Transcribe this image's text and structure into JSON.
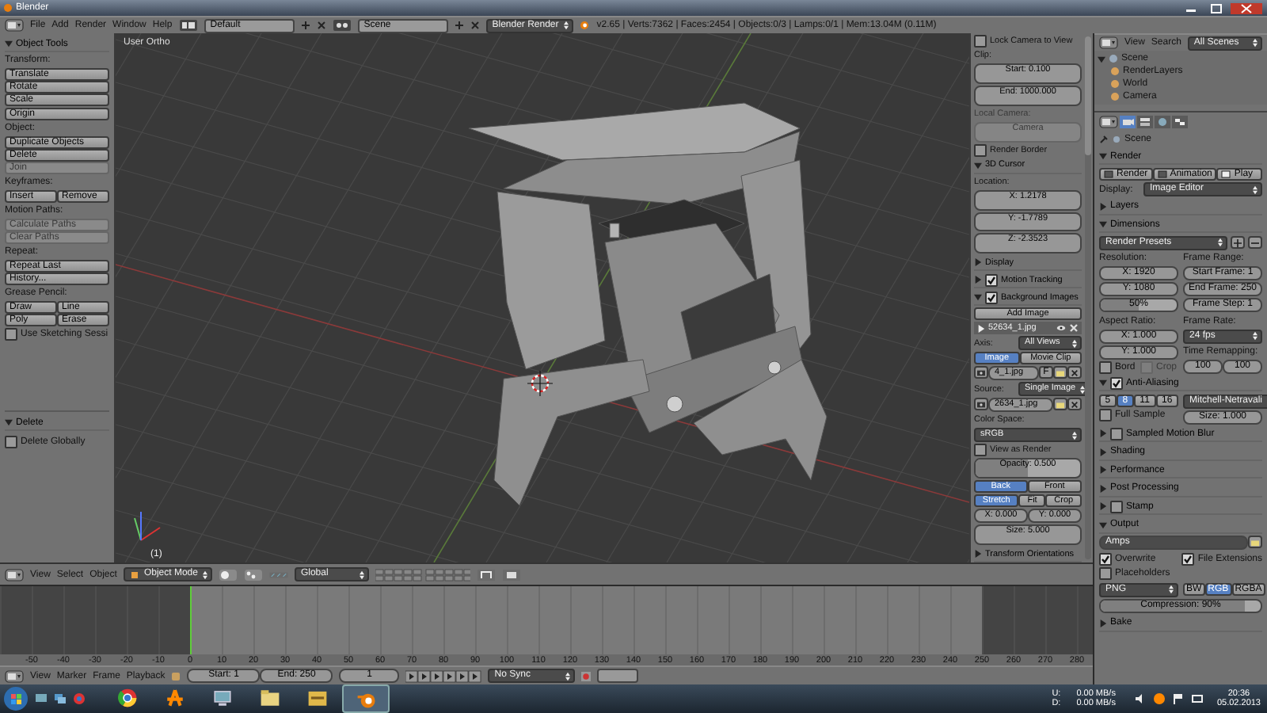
{
  "title_bar": {
    "title": "Blender"
  },
  "info_header": {
    "menus": [
      "File",
      "Add",
      "Render",
      "Window",
      "Help"
    ],
    "layout": "Default",
    "scene": "Scene",
    "engine": "Blender Render",
    "stats": "v2.65 | Verts:7362 | Faces:2454 | Objects:0/3 | Lamps:0/1 | Mem:13.04M (0.11M)"
  },
  "tool_shelf": {
    "items": [
      {
        "kind": "panel",
        "label": "Object Tools",
        "expanded": true
      },
      {
        "kind": "label",
        "text": "Transform:"
      },
      {
        "kind": "stack",
        "items": [
          {
            "label": "Translate",
            "disabled": false
          },
          {
            "label": "Rotate",
            "disabled": false
          },
          {
            "label": "Scale",
            "disabled": false
          }
        ]
      },
      {
        "kind": "stack",
        "items": [
          {
            "label": "Origin",
            "disabled": false
          }
        ]
      },
      {
        "kind": "label",
        "text": "Object:"
      },
      {
        "kind": "stack",
        "items": [
          {
            "label": "Duplicate Objects",
            "disabled": false
          },
          {
            "label": "Delete",
            "disabled": false
          },
          {
            "label": "Join",
            "disabled": true
          }
        ]
      },
      {
        "kind": "label",
        "text": "Keyframes:"
      },
      {
        "kind": "buttons",
        "items": [
          {
            "label": "Insert",
            "disabled": false
          },
          {
            "label": "Remove",
            "disabled": false
          }
        ]
      },
      {
        "kind": "label",
        "text": "Motion Paths:"
      },
      {
        "kind": "stack",
        "items": [
          {
            "label": "Calculate Paths",
            "disabled": true
          },
          {
            "label": "Clear Paths",
            "disabled": true
          }
        ]
      },
      {
        "kind": "label",
        "text": "Repeat:"
      },
      {
        "kind": "stack",
        "items": [
          {
            "label": "Repeat Last",
            "disabled": false
          },
          {
            "label": "History...",
            "disabled": false
          }
        ]
      },
      {
        "kind": "label",
        "text": "Grease Pencil:"
      },
      {
        "kind": "grid",
        "rows": [
          [
            {
              "label": "Draw",
              "disabled": false
            },
            {
              "label": "Line",
              "disabled": false
            }
          ],
          [
            {
              "label": "Poly",
              "disabled": false
            },
            {
              "label": "Erase",
              "disabled": false
            }
          ]
        ]
      },
      {
        "kind": "checkbox",
        "label": "Use Sketching Sessi",
        "checked": false
      }
    ],
    "operator_items": [
      {
        "kind": "panel",
        "label": "Delete",
        "expanded": true
      },
      {
        "kind": "checkbox",
        "label": "Delete Globally",
        "checked": false
      }
    ]
  },
  "viewport": {
    "view_name": "User Ortho",
    "frame": "(1)"
  },
  "n_panel": {
    "items": [
      {
        "kind": "checkbox",
        "label": "Lock Camera to View",
        "checked": false
      },
      {
        "kind": "label",
        "text": "Clip:"
      },
      {
        "kind": "field",
        "text": "Start: 0.100"
      },
      {
        "kind": "field",
        "text": "End: 1000.000"
      },
      {
        "kind": "label",
        "text": "Local Camera:",
        "disabled": true
      },
      {
        "kind": "field",
        "text": "Camera",
        "disabled": true
      },
      {
        "kind": "checkbox",
        "label": "Render Border",
        "checked": false
      },
      {
        "kind": "panel",
        "label": "3D Cursor",
        "expanded": true
      },
      {
        "kind": "label",
        "text": "Location:"
      },
      {
        "kind": "field",
        "text": "X: 1.2178"
      },
      {
        "kind": "field",
        "text": "Y: -1.7789"
      },
      {
        "kind": "field",
        "text": "Z: -2.3523"
      },
      {
        "kind": "panel",
        "label": "Display",
        "expanded": false
      },
      {
        "kind": "panel",
        "label": "Motion Tracking",
        "expanded": false,
        "checked": true
      },
      {
        "kind": "panel",
        "label": "Background Images",
        "expanded": true,
        "checked": true
      },
      {
        "kind": "button",
        "label": "Add Image"
      },
      {
        "kind": "image",
        "name": "52634_1.jpg"
      },
      {
        "kind": "dropdown",
        "label": "Axis:",
        "value": "All Views"
      },
      {
        "kind": "segmented",
        "items": [
          {
            "label": "Image",
            "selected": true
          },
          {
            "label": "Movie Clip",
            "selected": false
          }
        ]
      },
      {
        "kind": "image_select",
        "value": "4_1.jpg",
        "flag": "F"
      },
      {
        "kind": "dropdown",
        "label": "Source:",
        "value": "Single Image"
      },
      {
        "kind": "image_select",
        "value": "2634_1.jpg"
      },
      {
        "kind": "label",
        "text": "Color Space:"
      },
      {
        "kind": "dropdown",
        "value": "sRGB"
      },
      {
        "kind": "checkbox",
        "label": "View as Render",
        "checked": false
      },
      {
        "kind": "slider",
        "text": "Opacity: 0.500",
        "level": 0.5
      },
      {
        "kind": "segmented",
        "items": [
          {
            "label": "Back",
            "selected": true
          },
          {
            "label": "Front",
            "selected": false
          }
        ]
      },
      {
        "kind": "segmented",
        "items": [
          {
            "label": "Stretch",
            "selected": true
          },
          {
            "label": "Fit",
            "selected": false
          },
          {
            "label": "Crop",
            "selected": false
          }
        ]
      },
      {
        "kind": "fields",
        "items": [
          "X: 0.000",
          "Y: 0.000"
        ]
      },
      {
        "kind": "field",
        "text": "Size: 5.000"
      },
      {
        "kind": "panel",
        "label": "Transform Orientations",
        "expanded": false
      }
    ]
  },
  "outliner": {
    "menus": [
      "View",
      "Search"
    ],
    "filter": "All Scenes",
    "tree": [
      {
        "label": "Scene",
        "expanded": true,
        "children": [
          {
            "label": "RenderLayers"
          },
          {
            "label": "World"
          },
          {
            "label": "Camera"
          }
        ]
      }
    ]
  },
  "properties": {
    "tabs": [
      {
        "selected": true
      },
      {
        "selected": false
      },
      {
        "selected": false
      },
      {
        "selected": false
      }
    ],
    "context": "Scene",
    "items": [
      {
        "kind": "panel",
        "label": "Render",
        "expanded": true
      },
      {
        "kind": "buttons",
        "items": [
          {
            "label": "Render",
            "disabled": false
          },
          {
            "label": "Animation",
            "disabled": false
          },
          {
            "label": "Play",
            "disabled": false
          }
        ]
      },
      {
        "kind": "dropdown",
        "label": "Display:",
        "value": "Image Editor"
      },
      {
        "kind": "panel",
        "label": "Layers",
        "expanded": false
      },
      {
        "kind": "panel",
        "label": "Dimensions",
        "expanded": true
      },
      {
        "kind": "presets",
        "value": "Render Presets"
      },
      {
        "kind": "columns",
        "columns": [
          [
            {
              "kind": "label",
              "text": "Resolution:"
            },
            {
              "kind": "field",
              "text": "X: 1920"
            },
            {
              "kind": "field",
              "text": "Y: 1080"
            },
            {
              "kind": "slider",
              "text": "50%",
              "level": 0.5
            }
          ],
          [
            {
              "kind": "label",
              "text": "Frame Range:"
            },
            {
              "kind": "field",
              "text": "Start Frame: 1"
            },
            {
              "kind": "field",
              "text": "End Frame: 250"
            },
            {
              "kind": "field",
              "text": "Frame Step: 1"
            }
          ]
        ]
      },
      {
        "kind": "columns",
        "columns": [
          [
            {
              "kind": "label",
              "text": "Aspect Ratio:"
            },
            {
              "kind": "field",
              "text": "X: 1.000"
            },
            {
              "kind": "field",
              "text": "Y: 1.000"
            },
            {
              "kind": "checkboxes",
              "items": [
                {
                  "label": "Bord",
                  "checked": false,
                  "disabled": false
                },
                {
                  "label": "Crop",
                  "checked": false,
                  "disabled": true
                }
              ]
            }
          ],
          [
            {
              "kind": "label",
              "text": "Frame Rate:"
            },
            {
              "kind": "dropdown",
              "value": "24 fps"
            },
            {
              "kind": "label",
              "text": "Time Remapping:"
            },
            {
              "kind": "fields",
              "items": [
                "100",
                "100"
              ]
            }
          ]
        ]
      },
      {
        "kind": "panel",
        "label": "Anti-Aliasing",
        "expanded": true,
        "checked": true
      },
      {
        "kind": "columns",
        "columns": [
          [
            {
              "kind": "segmented",
              "items": [
                {
                  "label": "5",
                  "selected": false
                },
                {
                  "label": "8",
                  "selected": true
                },
                {
                  "label": "11",
                  "selected": false
                },
                {
                  "label": "16",
                  "selected": false
                }
              ]
            },
            {
              "kind": "checkbox",
              "label": "Full Sample",
              "checked": false
            }
          ],
          [
            {
              "kind": "dropdown",
              "value": "Mitchell-Netravali"
            },
            {
              "kind": "field",
              "text": "Size: 1.000"
            }
          ]
        ]
      },
      {
        "kind": "panel",
        "label": "Sampled Motion Blur",
        "expanded": false,
        "checked": false
      },
      {
        "kind": "panel",
        "label": "Shading",
        "expanded": false
      },
      {
        "kind": "panel",
        "label": "Performance",
        "expanded": false
      },
      {
        "kind": "panel",
        "label": "Post Processing",
        "expanded": false
      },
      {
        "kind": "panel",
        "label": "Stamp",
        "expanded": false,
        "checked": false
      },
      {
        "kind": "panel",
        "label": "Output",
        "expanded": true
      },
      {
        "kind": "path",
        "value": "Amps"
      },
      {
        "kind": "checkboxes",
        "items": [
          {
            "label": "Overwrite",
            "checked": true,
            "disabled": false
          },
          {
            "label": "File Extensions",
            "checked": true,
            "disabled": false
          }
        ]
      },
      {
        "kind": "checkbox",
        "label": "Placeholders",
        "checked": false
      },
      {
        "kind": "columns",
        "columns": [
          [
            {
              "kind": "dropdown",
              "value": "PNG"
            }
          ],
          [
            {
              "kind": "segmented",
              "items": [
                {
                  "label": "BW",
                  "selected": false
                },
                {
                  "label": "RGB",
                  "selected": true
                },
                {
                  "label": "RGBA",
                  "selected": false
                }
              ]
            }
          ]
        ]
      },
      {
        "kind": "slider",
        "text": "Compression: 90%",
        "level": 0.9
      },
      {
        "kind": "panel",
        "label": "Bake",
        "expanded": false
      }
    ]
  },
  "view3d_header": {
    "menus": [
      "View",
      "Select",
      "Object"
    ],
    "mode": "Object Mode",
    "orientation": "Global"
  },
  "timeline": {
    "ruler": [
      "-50",
      "-40",
      "-30",
      "-20",
      "-10",
      "0",
      "10",
      "20",
      "30",
      "40",
      "50",
      "60",
      "70",
      "80",
      "90",
      "100",
      "110",
      "120",
      "130",
      "140",
      "150",
      "160",
      "170",
      "180",
      "190",
      "200",
      "210",
      "220",
      "230",
      "240",
      "250",
      "260",
      "270",
      "280"
    ],
    "menus": [
      "View",
      "Marker",
      "Frame",
      "Playback"
    ],
    "start": "Start: 1",
    "end": "End: 250",
    "frame": "1",
    "sync": "No Sync"
  },
  "taskbar": {
    "apps": [
      {
        "selected": false
      },
      {
        "selected": false
      },
      {
        "selected": false
      },
      {
        "selected": false
      },
      {
        "selected": false
      },
      {
        "selected": true
      }
    ],
    "up_label": "U:",
    "up": "0.00 MB/s",
    "down_label": "D:",
    "down": "0.00 MB/s",
    "time": "20:36",
    "date": "05.02.2013"
  }
}
